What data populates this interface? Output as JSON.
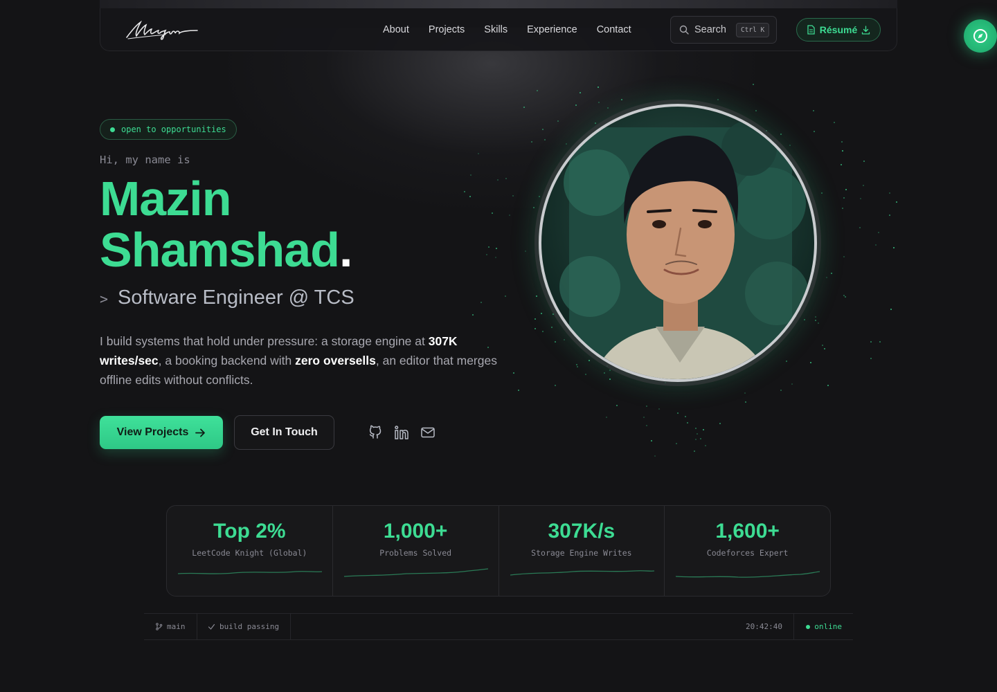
{
  "nav": {
    "links": [
      "About",
      "Projects",
      "Skills",
      "Experience",
      "Contact"
    ],
    "search_label": "Search",
    "search_shortcut": "Ctrl K",
    "resume_label": "Résumé"
  },
  "hero": {
    "badge": "open to opportunities",
    "greeting": "Hi, my name is",
    "first_name": "Mazin",
    "last_name": "Shamshad",
    "name_dot": ".",
    "role_prompt": ">",
    "role": "Software Engineer @ TCS",
    "bio": {
      "p1": "I build systems that hold under pressure: a storage engine at ",
      "b1": "307K writes/sec",
      "p2": ", a booking backend with ",
      "b2": "zero oversells",
      "p3": ", an editor that merges offline edits without conflicts."
    },
    "primary_button": "View Projects",
    "secondary_button": "Get In Touch"
  },
  "stats": [
    {
      "value": "Top 2%",
      "label": "LeetCode Knight (Global)"
    },
    {
      "value": "1,000+",
      "label": "Problems Solved"
    },
    {
      "value": "307K/s",
      "label": "Storage Engine Writes"
    },
    {
      "value": "1,600+",
      "label": "Codeforces Expert"
    }
  ],
  "statusbar": {
    "branch": "main",
    "build": "build passing",
    "time": "20:42:40",
    "status": "online"
  },
  "colors": {
    "accent": "#3ddc93",
    "background": "#141416"
  }
}
